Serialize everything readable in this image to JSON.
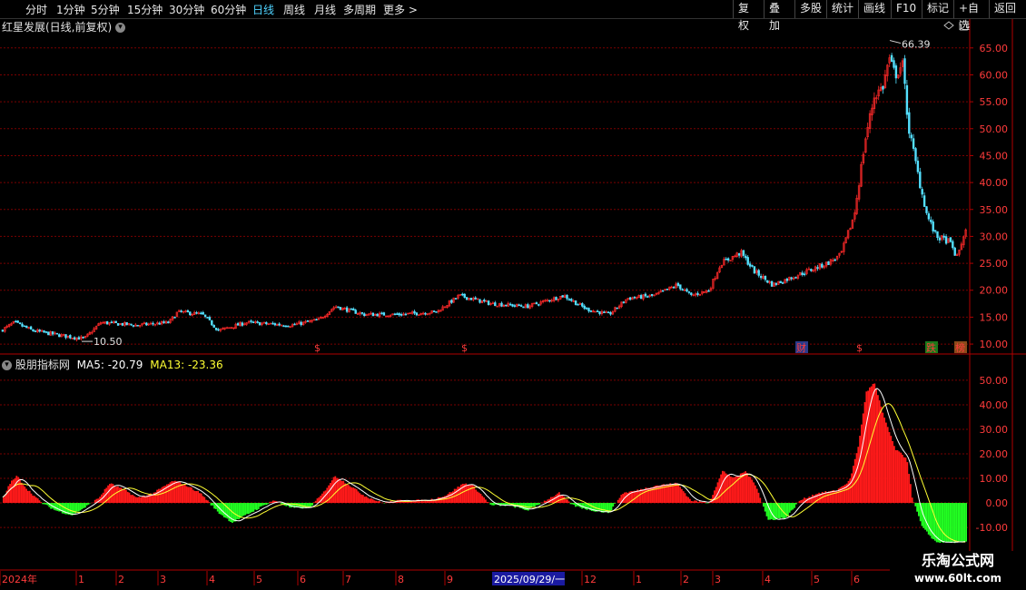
{
  "toolbar": {
    "periods": [
      "分时",
      "1分钟",
      "5分钟",
      "15分钟",
      "30分钟",
      "60分钟",
      "日线",
      "周线",
      "月线",
      "多周期",
      "更多 >"
    ],
    "active_period": "日线",
    "actions": [
      "复权",
      "叠加",
      "多股",
      "统计",
      "画线",
      "F10",
      "标记",
      "+自选",
      "返回"
    ]
  },
  "main_panel": {
    "title": "红星发展(日线,前复权)"
  },
  "indicator_panel": {
    "name": "股朋指标网",
    "ma5_label": "MA5: -20.79",
    "ma13_label": "MA13: -23.36"
  },
  "watermark": {
    "line1": "乐淘公式网",
    "line2": "www.60lt.com"
  },
  "colors": {
    "up": "#ff2a2a",
    "down": "#54e0ff",
    "grid": "#7a0000",
    "ma5": "#ffffff",
    "ma13": "#ffff33",
    "bar_pos": "#ff1a1a",
    "bar_neg": "#22ff22"
  },
  "chart_data": [
    {
      "type": "candlestick",
      "title": "红星发展(日线,前复权)",
      "yticks": [
        "65.00",
        "60.00",
        "55.00",
        "50.00",
        "45.00",
        "40.00",
        "35.00",
        "30.00",
        "25.00",
        "20.00",
        "15.00",
        "10.00"
      ],
      "ylim": [
        9,
        68
      ],
      "annotations": {
        "high": "66.39",
        "low": "10.50"
      },
      "event_markers": [
        "$",
        "$",
        "财",
        "$",
        "跌",
        "榜"
      ],
      "close_trend": [
        [
          0,
          12.5
        ],
        [
          15,
          14
        ],
        [
          35,
          12.5
        ],
        [
          70,
          11.5
        ],
        [
          92,
          11
        ],
        [
          110,
          14
        ],
        [
          150,
          13.5
        ],
        [
          185,
          14
        ],
        [
          195,
          16
        ],
        [
          222,
          15.5
        ],
        [
          240,
          12.5
        ],
        [
          270,
          14
        ],
        [
          320,
          13.5
        ],
        [
          350,
          14.5
        ],
        [
          368,
          17
        ],
        [
          400,
          15.5
        ],
        [
          440,
          15.5
        ],
        [
          480,
          16
        ],
        [
          505,
          19
        ],
        [
          540,
          17.5
        ],
        [
          580,
          17
        ],
        [
          620,
          19
        ],
        [
          645,
          16.5
        ],
        [
          670,
          15.5
        ],
        [
          690,
          18.5
        ],
        [
          720,
          19
        ],
        [
          745,
          21
        ],
        [
          760,
          19
        ],
        [
          780,
          20
        ],
        [
          793,
          25
        ],
        [
          815,
          27
        ],
        [
          830,
          23.5
        ],
        [
          850,
          21
        ],
        [
          880,
          23
        ],
        [
          910,
          25
        ],
        [
          925,
          26.5
        ],
        [
          940,
          34
        ],
        [
          952,
          48
        ],
        [
          962,
          56
        ],
        [
          972,
          58
        ],
        [
          978,
          63
        ],
        [
          985,
          60
        ],
        [
          993,
          62
        ],
        [
          1000,
          50
        ],
        [
          1012,
          40
        ],
        [
          1020,
          34
        ],
        [
          1030,
          30
        ],
        [
          1045,
          29
        ],
        [
          1053,
          26
        ],
        [
          1062,
          31
        ]
      ]
    },
    {
      "type": "bar",
      "title": "股朋指标网",
      "series": [
        {
          "name": "MA5",
          "last": "-20.79"
        },
        {
          "name": "MA13",
          "last": "-23.36"
        }
      ],
      "yticks": [
        "50.00",
        "40.00",
        "30.00",
        "20.00",
        "10.00",
        "0.00",
        "-10.00"
      ],
      "ylim": [
        -17,
        57
      ],
      "trend": [
        [
          3,
          2
        ],
        [
          10,
          8
        ],
        [
          18,
          11
        ],
        [
          28,
          6
        ],
        [
          45,
          0
        ],
        [
          60,
          -3
        ],
        [
          78,
          -5
        ],
        [
          92,
          -2
        ],
        [
          108,
          2
        ],
        [
          120,
          8
        ],
        [
          138,
          5
        ],
        [
          150,
          2
        ],
        [
          168,
          4
        ],
        [
          190,
          9
        ],
        [
          200,
          8
        ],
        [
          220,
          4
        ],
        [
          240,
          -4
        ],
        [
          255,
          -8
        ],
        [
          275,
          -4
        ],
        [
          300,
          1
        ],
        [
          320,
          -2
        ],
        [
          340,
          -2
        ],
        [
          355,
          4
        ],
        [
          368,
          11
        ],
        [
          385,
          7
        ],
        [
          400,
          3
        ],
        [
          420,
          0
        ],
        [
          440,
          1
        ],
        [
          470,
          1
        ],
        [
          490,
          3
        ],
        [
          510,
          8
        ],
        [
          520,
          7
        ],
        [
          540,
          -1
        ],
        [
          560,
          -1
        ],
        [
          580,
          -3
        ],
        [
          600,
          1
        ],
        [
          615,
          4
        ],
        [
          630,
          -1
        ],
        [
          650,
          -3
        ],
        [
          670,
          -4
        ],
        [
          685,
          4
        ],
        [
          700,
          5
        ],
        [
          720,
          7
        ],
        [
          745,
          8
        ],
        [
          760,
          1
        ],
        [
          780,
          0
        ],
        [
          795,
          13
        ],
        [
          808,
          10
        ],
        [
          820,
          13
        ],
        [
          832,
          7
        ],
        [
          845,
          -7
        ],
        [
          865,
          -6
        ],
        [
          880,
          1
        ],
        [
          900,
          4
        ],
        [
          920,
          5
        ],
        [
          935,
          9
        ],
        [
          945,
          24
        ],
        [
          953,
          45
        ],
        [
          962,
          49
        ],
        [
          972,
          36
        ],
        [
          985,
          22
        ],
        [
          998,
          18
        ],
        [
          1004,
          2
        ],
        [
          1015,
          -10
        ],
        [
          1030,
          -16
        ],
        [
          1063,
          -16
        ]
      ]
    }
  ],
  "x_axis": {
    "labels": [
      "2024年",
      "1",
      "2",
      "3",
      "4",
      "5",
      "6",
      "7",
      "8",
      "9",
      "2025/09/29/一",
      "12",
      "1",
      "2",
      "3",
      "4",
      "5",
      "6"
    ]
  }
}
